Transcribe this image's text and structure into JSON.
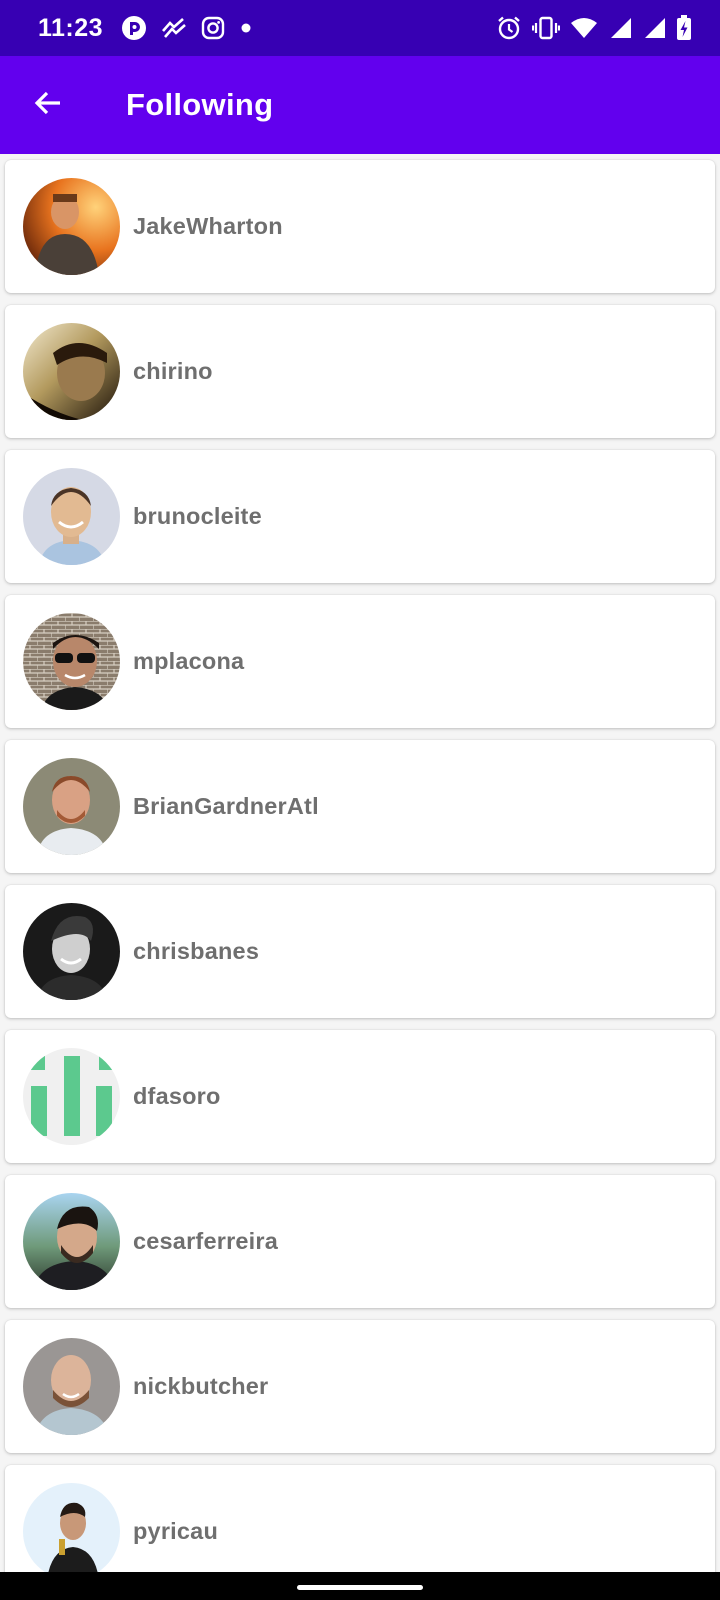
{
  "status_bar": {
    "time": "11:23",
    "left_icons": [
      "app-notification-icon",
      "trending-icon",
      "instagram-icon",
      "dot-icon"
    ],
    "right_icons": [
      "alarm-icon",
      "vibrate-icon",
      "wifi-icon",
      "signal-icon",
      "signal-icon",
      "battery-charging-icon"
    ]
  },
  "app_bar": {
    "back_icon": "arrow-left-icon",
    "title": "Following"
  },
  "following": [
    {
      "username": "JakeWharton"
    },
    {
      "username": "chirino"
    },
    {
      "username": "brunocleite"
    },
    {
      "username": "mplacona"
    },
    {
      "username": "BrianGardnerAtl"
    },
    {
      "username": "chrisbanes"
    },
    {
      "username": "dfasoro"
    },
    {
      "username": "cesarferreira"
    },
    {
      "username": "nickbutcher"
    },
    {
      "username": "pyricau"
    }
  ],
  "colors": {
    "status_bar": "#3700b3",
    "app_bar": "#6200ee",
    "card": "#ffffff",
    "username_text": "#6f6f6f",
    "background": "#f5f5f5"
  }
}
